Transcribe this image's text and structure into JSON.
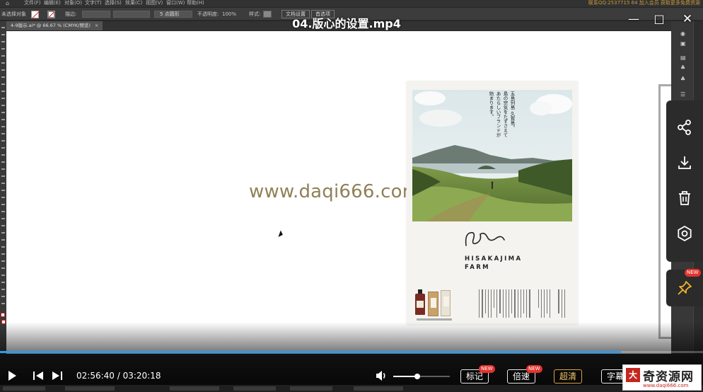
{
  "illustrator": {
    "menu": [
      "文件(F)",
      "编辑(E)",
      "对象(O)",
      "文字(T)",
      "选择(S)",
      "效果(C)",
      "视图(V)",
      "窗口(W)",
      "帮助(H)"
    ],
    "promo_text": "联系QQ:2537715 64 加入会员 获取更多免费资源",
    "control_bar": {
      "selection_label": "未选择对象",
      "stroke_label": "描边:",
      "brush_label": "5 点圆形",
      "opacity_label": "不透明度:",
      "opacity_value": "100%",
      "style_label": "样式:",
      "doc_setup_button": "文档设置",
      "prefs_button": "首选项"
    },
    "doc_tab": "4-9版示.ai* @ 66.67 % (CMYK/预览)",
    "doc_tab_close": "×"
  },
  "canvas": {
    "watermark": "www.daqi666.com"
  },
  "poster": {
    "vertical_text": [
      "五島列島 久賀島。",
      "島の空気をたずさえて",
      "あたらしいブランドが",
      "始まります。"
    ],
    "brand_line1": "HISAKAJIMA",
    "brand_line2": "FARM"
  },
  "player": {
    "title": "04.版心的设置.mp4",
    "minimize_icon": "—",
    "maximize_icon": "□",
    "close_icon": "✕",
    "progress_fraction": 0.883,
    "volume_fraction": 0.43,
    "time_current": "02:56:40",
    "time_separator": " / ",
    "time_total": "03:20:18",
    "buttons": {
      "mark": "标记",
      "speed": "倍速",
      "quality": "超清",
      "subtitle": "字幕"
    },
    "badges": {
      "mark_new": "NEW",
      "speed_new": "NEW",
      "pin_new": "NEW"
    },
    "accent": "#2e9bf0",
    "quality_color": "#d9a441"
  },
  "site_stamp": {
    "seal_char": "大",
    "name": "奇资源网",
    "url": "www.daqi666.com"
  }
}
